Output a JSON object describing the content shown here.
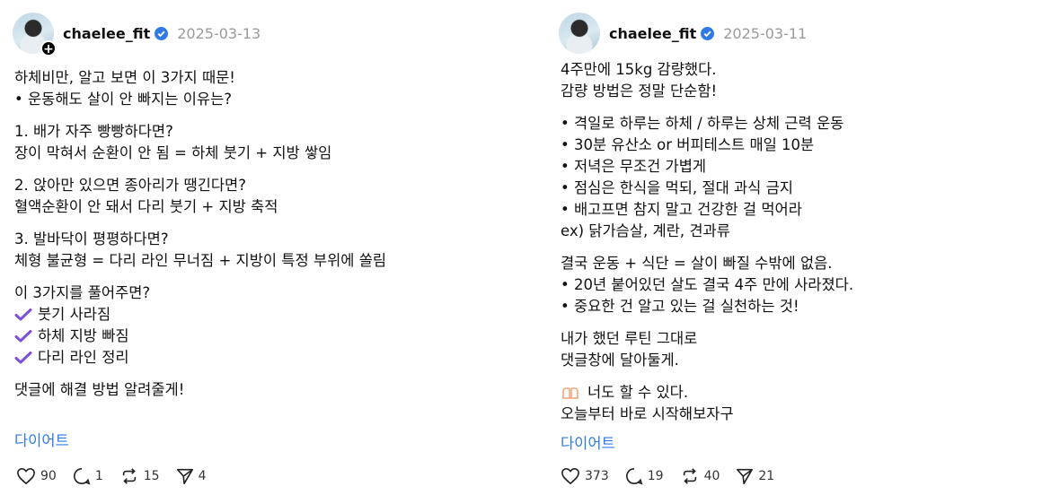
{
  "posts": [
    {
      "username": "chaelee_fit",
      "date": "2025-03-13",
      "lines": [
        "하체비만, 알고 보면 이 3가지 때문!",
        "• 운동해도 살이 안 빠지는 이유는?",
        "",
        "1. 배가 자주 빵빵하다면?",
        "장이 막혀서 순환이 안 됨 = 하체 붓기 + 지방 쌓임",
        "",
        "2. 앉아만 있으면 종아리가 땡긴다면?",
        "혈액순환이 안 돼서 다리 붓기 + 지방 축적",
        "",
        "3. 발바닥이 평평하다면?",
        "체형 불균형 = 다리 라인 무너짐 + 지방이 특정 부위에 쏠림",
        "",
        "이 3가지를 풀어주면?"
      ],
      "checks": [
        "붓기 사라짐",
        "하체 지방 빠짐",
        "다리 라인 정리"
      ],
      "closing": "댓글에 해결 방법 알려줄게!",
      "tag": "다이어트",
      "stats": {
        "likes": "90",
        "comments": "1",
        "reposts": "15",
        "shares": "4"
      }
    },
    {
      "username": "chaelee_fit",
      "date": "2025-03-11",
      "lines": [
        "4주만에 15kg 감량했다.",
        "감량 방법은 정말 단순함!",
        "",
        "• 격일로 하루는 하체 / 하루는 상체 근력 운동",
        "• 30분 유산소 or 버피테스트 매일 10분",
        "• 저녁은 무조건 가볍게",
        "• 점심은 한식을 먹되, 절대 과식 금지",
        "• 배고프면 참지 말고 건강한 걸 먹어라",
        "ex) 닭가슴살, 계란, 견과류",
        "",
        "결국 운동 + 식단 = 살이 빠질 수밖에 없음.",
        "• 20년 붙어있던 살도 결국 4주 만에 사라졌다.",
        "• 중요한 건 알고 있는 걸 실천하는 것!",
        "",
        "내가 했던 루틴 그대로",
        "댓글창에 달아둘게.",
        "",
        "너도 할 수 있다.",
        "오늘부터 바로 시작해보자구"
      ],
      "tag": "다이어트",
      "stats": {
        "likes": "373",
        "comments": "19",
        "reposts": "40",
        "shares": "21"
      }
    }
  ],
  "colors": {
    "verified": "#2f7ae5",
    "check": "#7b4fd6",
    "tag": "#2f7ae5",
    "muted": "#9a9a9a",
    "hands": "#f2a679"
  },
  "icons": [
    "verified-badge-icon",
    "heart-icon",
    "comment-icon",
    "repost-icon",
    "share-icon",
    "checkmark-icon",
    "raised-hands-icon",
    "follow-plus-icon"
  ]
}
